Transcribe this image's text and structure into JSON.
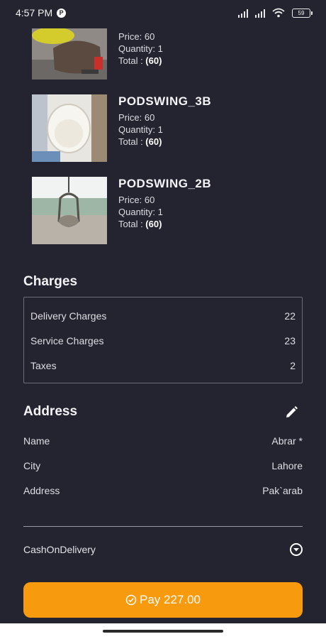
{
  "status_bar": {
    "time": "4:57 PM",
    "app_badge": "P",
    "battery": "59"
  },
  "products": [
    {
      "title": "",
      "price": "Price: 60",
      "quantity": "Quantity: 1",
      "total_label": "Total : ",
      "total_value": "(60)",
      "image": "pouf-chair-photo"
    },
    {
      "title": "PODSWING_3B",
      "price": "Price: 60",
      "quantity": "Quantity: 1",
      "total_label": "Total : ",
      "total_value": "(60)",
      "image": "pod-swing-white-photo"
    },
    {
      "title": "PODSWING_2B",
      "price": "Price: 60",
      "quantity": "Quantity: 1",
      "total_label": "Total : ",
      "total_value": "(60)",
      "image": "pod-swing-hanging-photo"
    }
  ],
  "charges": {
    "title": "Charges",
    "rows": [
      {
        "label": "Delivery Charges",
        "value": "22"
      },
      {
        "label": "Service Charges",
        "value": "23"
      },
      {
        "label": "Taxes",
        "value": "2"
      }
    ]
  },
  "address": {
    "title": "Address",
    "edit_icon": "pencil-icon",
    "rows": [
      {
        "label": "Name",
        "value": "Abrar *"
      },
      {
        "label": "City",
        "value": "Lahore"
      },
      {
        "label": "Address",
        "value": "Pak`arab"
      }
    ]
  },
  "payment": {
    "method": "CashOnDelivery",
    "icon": "chevron-down-circle-icon"
  },
  "pay_button": {
    "label": "Pay 227.00",
    "icon": "check-circle-icon"
  },
  "colors": {
    "background": "#23242f",
    "accent": "#f79a0e",
    "border": "#6c6d78"
  }
}
